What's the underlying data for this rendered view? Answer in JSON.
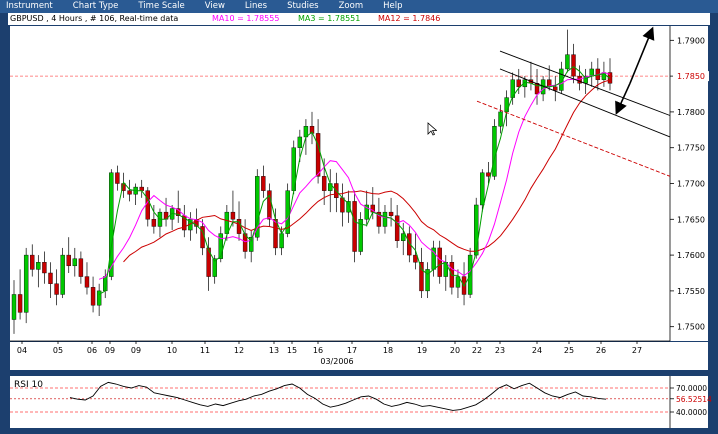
{
  "menu": [
    "Instrument",
    "Chart Type",
    "Time Scale",
    "View",
    "Lines",
    "Studies",
    "Zoom",
    "Help"
  ],
  "chart_header": {
    "symbol_info": "GBPUSD , 4 Hours , # 106, Real-time data",
    "ma10": "MA10 = 1.78555",
    "ma3": "MA3 = 1.78551",
    "ma12": "MA12 = 1.7846"
  },
  "colors": {
    "up_candle": "#00c800",
    "down_candle": "#c80000",
    "ma10": "#ff00ff",
    "ma3": "#00a000",
    "ma12": "#cc0000",
    "frame": "#1c3f6e",
    "menubar": "#2a5a93"
  },
  "chart_data": [
    {
      "type": "candlestick",
      "xlabel": "03/2006",
      "x_ticks": [
        "04",
        "05",
        "06",
        "09",
        "09",
        "10",
        "11",
        "12",
        "13",
        "15",
        "16",
        "17",
        "18",
        "19",
        "20",
        "22",
        "23",
        "24",
        "25",
        "26",
        "27"
      ],
      "y_ticks": [
        "1.7900",
        "1.7850",
        "1.7800",
        "1.7750",
        "1.7700",
        "1.7650",
        "1.7600",
        "1.7550",
        "1.7500"
      ],
      "y_range": [
        1.748,
        1.792
      ],
      "current_price_label": "1.7850",
      "current_price": 1.785,
      "overlays": [
        "MA10",
        "MA3",
        "MA12",
        "channel lines",
        "arrows"
      ],
      "grid": false,
      "candles_ohlc": [
        [
          1.751,
          1.7565,
          1.749,
          1.7545
        ],
        [
          1.7545,
          1.758,
          1.751,
          1.752
        ],
        [
          1.752,
          1.761,
          1.7505,
          1.76
        ],
        [
          1.76,
          1.7615,
          1.757,
          1.758
        ],
        [
          1.758,
          1.76,
          1.7555,
          1.759
        ],
        [
          1.759,
          1.7605,
          1.756,
          1.7575
        ],
        [
          1.7575,
          1.759,
          1.754,
          1.756
        ],
        [
          1.756,
          1.758,
          1.753,
          1.7545
        ],
        [
          1.7545,
          1.761,
          1.754,
          1.76
        ],
        [
          1.76,
          1.7625,
          1.7575,
          1.7585
        ],
        [
          1.7585,
          1.761,
          1.757,
          1.7595
        ],
        [
          1.7595,
          1.7605,
          1.756,
          1.757
        ],
        [
          1.757,
          1.759,
          1.7545,
          1.7555
        ],
        [
          1.7555,
          1.757,
          1.752,
          1.753
        ],
        [
          1.753,
          1.756,
          1.7515,
          1.755
        ],
        [
          1.755,
          1.758,
          1.754,
          1.757
        ],
        [
          1.757,
          1.772,
          1.7565,
          1.7715
        ],
        [
          1.7715,
          1.7725,
          1.769,
          1.77
        ],
        [
          1.77,
          1.7715,
          1.768,
          1.769
        ],
        [
          1.769,
          1.7705,
          1.7675,
          1.7685
        ],
        [
          1.7685,
          1.77,
          1.767,
          1.7695
        ],
        [
          1.7695,
          1.7705,
          1.768,
          1.769
        ],
        [
          1.769,
          1.7695,
          1.764,
          1.765
        ],
        [
          1.765,
          1.767,
          1.763,
          1.764
        ],
        [
          1.764,
          1.7665,
          1.7625,
          1.766
        ],
        [
          1.766,
          1.768,
          1.764,
          1.765
        ],
        [
          1.765,
          1.767,
          1.7635,
          1.7665
        ],
        [
          1.7665,
          1.769,
          1.7645,
          1.7655
        ],
        [
          1.7655,
          1.767,
          1.7625,
          1.7635
        ],
        [
          1.7635,
          1.766,
          1.762,
          1.765
        ],
        [
          1.765,
          1.7665,
          1.763,
          1.764
        ],
        [
          1.764,
          1.765,
          1.76,
          1.761
        ],
        [
          1.761,
          1.7625,
          1.755,
          1.757
        ],
        [
          1.757,
          1.76,
          1.756,
          1.7595
        ],
        [
          1.7595,
          1.764,
          1.759,
          1.763
        ],
        [
          1.763,
          1.767,
          1.762,
          1.766
        ],
        [
          1.766,
          1.769,
          1.764,
          1.765
        ],
        [
          1.765,
          1.7675,
          1.762,
          1.763
        ],
        [
          1.763,
          1.765,
          1.7595,
          1.7605
        ],
        [
          1.7605,
          1.7635,
          1.759,
          1.7625
        ],
        [
          1.7625,
          1.772,
          1.762,
          1.771
        ],
        [
          1.771,
          1.7725,
          1.768,
          1.769
        ],
        [
          1.769,
          1.77,
          1.764,
          1.765
        ],
        [
          1.765,
          1.7665,
          1.76,
          1.761
        ],
        [
          1.761,
          1.764,
          1.76,
          1.763
        ],
        [
          1.763,
          1.77,
          1.7625,
          1.769
        ],
        [
          1.769,
          1.776,
          1.7685,
          1.775
        ],
        [
          1.775,
          1.7775,
          1.773,
          1.7765
        ],
        [
          1.7765,
          1.779,
          1.774,
          1.778
        ],
        [
          1.778,
          1.78,
          1.7755,
          1.777
        ],
        [
          1.777,
          1.779,
          1.77,
          1.771
        ],
        [
          1.771,
          1.7735,
          1.767,
          1.769
        ],
        [
          1.769,
          1.772,
          1.766,
          1.77
        ],
        [
          1.77,
          1.7715,
          1.766,
          1.768
        ],
        [
          1.768,
          1.77,
          1.764,
          1.766
        ],
        [
          1.766,
          1.769,
          1.7645,
          1.7675
        ],
        [
          1.7675,
          1.769,
          1.759,
          1.7605
        ],
        [
          1.7605,
          1.766,
          1.76,
          1.765
        ],
        [
          1.765,
          1.769,
          1.764,
          1.767
        ],
        [
          1.767,
          1.7695,
          1.765,
          1.766
        ],
        [
          1.766,
          1.768,
          1.763,
          1.764
        ],
        [
          1.764,
          1.767,
          1.763,
          1.766
        ],
        [
          1.766,
          1.768,
          1.764,
          1.7655
        ],
        [
          1.7655,
          1.767,
          1.761,
          1.762
        ],
        [
          1.762,
          1.7645,
          1.76,
          1.763
        ],
        [
          1.763,
          1.764,
          1.759,
          1.76
        ],
        [
          1.76,
          1.763,
          1.758,
          1.759
        ],
        [
          1.759,
          1.761,
          1.754,
          1.755
        ],
        [
          1.755,
          1.759,
          1.754,
          1.758
        ],
        [
          1.758,
          1.762,
          1.757,
          1.761
        ],
        [
          1.761,
          1.762,
          1.756,
          1.757
        ],
        [
          1.757,
          1.76,
          1.755,
          1.759
        ],
        [
          1.759,
          1.76,
          1.7545,
          1.7555
        ],
        [
          1.7555,
          1.758,
          1.754,
          1.757
        ],
        [
          1.757,
          1.759,
          1.753,
          1.7545
        ],
        [
          1.7545,
          1.761,
          1.754,
          1.76
        ],
        [
          1.76,
          1.768,
          1.7595,
          1.767
        ],
        [
          1.767,
          1.772,
          1.766,
          1.7715
        ],
        [
          1.7715,
          1.773,
          1.77,
          1.771
        ],
        [
          1.771,
          1.779,
          1.7705,
          1.778
        ],
        [
          1.778,
          1.781,
          1.777,
          1.78
        ],
        [
          1.78,
          1.783,
          1.778,
          1.782
        ],
        [
          1.782,
          1.7855,
          1.781,
          1.7845
        ],
        [
          1.7845,
          1.786,
          1.7825,
          1.7835
        ],
        [
          1.7835,
          1.785,
          1.782,
          1.7845
        ],
        [
          1.7845,
          1.787,
          1.783,
          1.784
        ],
        [
          1.784,
          1.786,
          1.781,
          1.7825
        ],
        [
          1.7825,
          1.785,
          1.7815,
          1.7845
        ],
        [
          1.7845,
          1.7865,
          1.783,
          1.7835
        ],
        [
          1.7835,
          1.785,
          1.7815,
          1.783
        ],
        [
          1.783,
          1.787,
          1.7825,
          1.786
        ],
        [
          1.786,
          1.7915,
          1.7855,
          1.788
        ],
        [
          1.788,
          1.7895,
          1.784,
          1.785
        ],
        [
          1.785,
          1.7865,
          1.783,
          1.784
        ],
        [
          1.784,
          1.786,
          1.7825,
          1.785
        ],
        [
          1.785,
          1.787,
          1.7835,
          1.786
        ],
        [
          1.786,
          1.7875,
          1.783,
          1.7845
        ],
        [
          1.7845,
          1.787,
          1.7835,
          1.7855
        ],
        [
          1.7855,
          1.7875,
          1.783,
          1.784
        ]
      ],
      "channel_lines": [
        {
          "from": [
            "23",
            1.7885
          ],
          "to": [
            "27",
            1.7795
          ]
        },
        {
          "from": [
            "23",
            1.786
          ],
          "to": [
            "27",
            1.7765
          ]
        },
        {
          "from": [
            "22",
            1.7815
          ],
          "to": [
            "27",
            1.771
          ],
          "dashed": true
        }
      ],
      "arrows": [
        {
          "from": [
            "26",
            1.787
          ],
          "to": [
            "27",
            1.7915
          ]
        },
        {
          "from": [
            "26",
            1.787
          ],
          "to": [
            "26",
            1.78
          ]
        }
      ]
    },
    {
      "type": "line",
      "title": "RSI 10",
      "y_ticks": [
        "70.0000",
        "56.52514",
        "40.0000"
      ],
      "y_range": [
        20,
        85
      ],
      "reference_levels": [
        70,
        40
      ],
      "current_value": 56.52514,
      "values": [
        58,
        56,
        55,
        60,
        72,
        77,
        75,
        72,
        70,
        73,
        71,
        64,
        62,
        60,
        58,
        55,
        52,
        49,
        47,
        50,
        48,
        51,
        54,
        56,
        60,
        62,
        66,
        69,
        73,
        75,
        70,
        62,
        57,
        50,
        46,
        48,
        51,
        55,
        59,
        60,
        56,
        50,
        47,
        49,
        52,
        50,
        47,
        48,
        46,
        44,
        42,
        43,
        46,
        49,
        55,
        62,
        70,
        74,
        69,
        73,
        76,
        70,
        64,
        60,
        58,
        62,
        65,
        60,
        59,
        57,
        56
      ]
    }
  ]
}
